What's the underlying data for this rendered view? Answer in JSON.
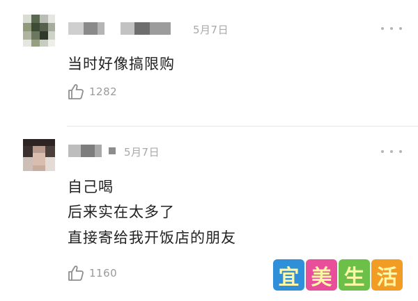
{
  "comments": [
    {
      "date": "5月7日",
      "lines": [
        "当时好像搞限购"
      ],
      "likes": "1282"
    },
    {
      "date": "5月7日",
      "lines": [
        "自己喝",
        "后来实在太多了",
        "直接寄给我开饭店的朋友"
      ],
      "likes": "1160"
    }
  ],
  "icons": {
    "like": "thumbs-up-icon",
    "more": "more-dots-icon"
  },
  "watermark": {
    "chars": [
      "宜",
      "美",
      "生",
      "活"
    ],
    "colors": {
      "char1_bg": "#2f8fd8",
      "char2_bg": "#e94e9b",
      "char3_bg": "#6cc04a",
      "char4_bg": "#f39c25",
      "char_fg": "#fff7a8"
    }
  },
  "colors": {
    "text": "#222222",
    "meta": "#a8a8a8",
    "divider": "#e6e6e6"
  }
}
